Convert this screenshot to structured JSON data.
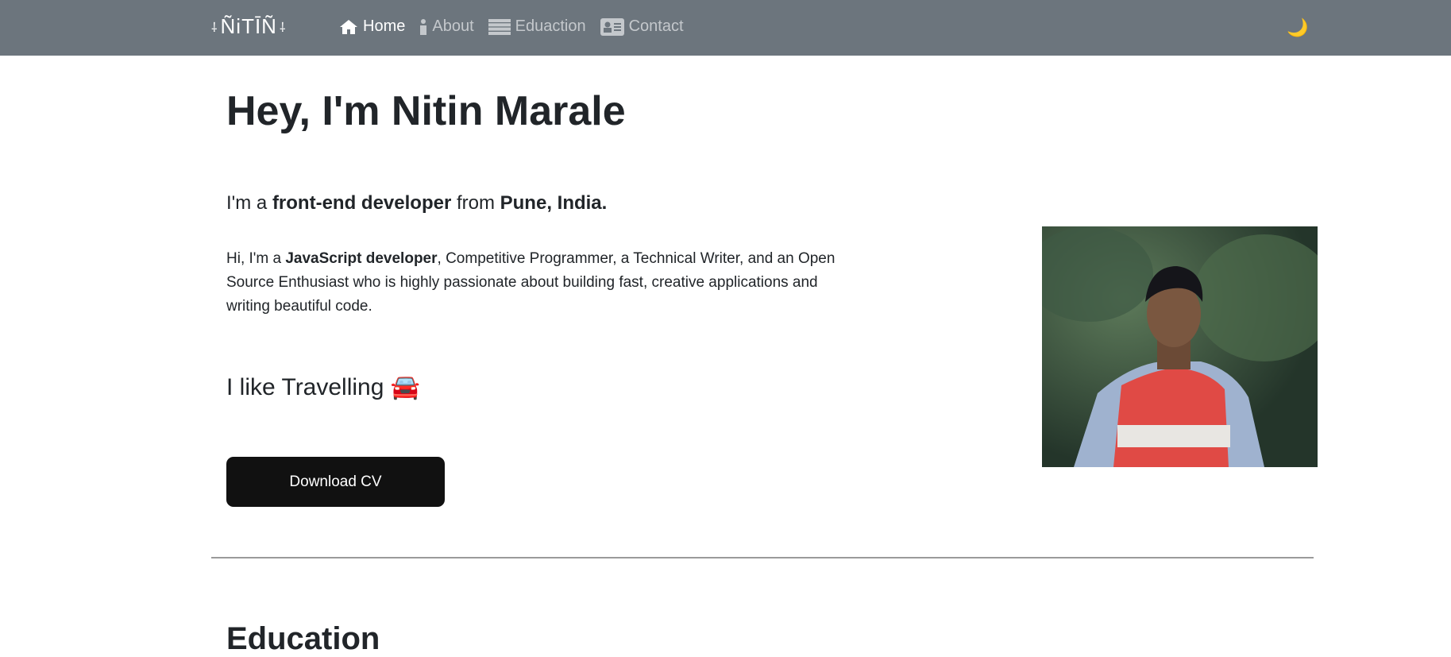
{
  "nav": {
    "logo": "ÑiTĪÑ",
    "logo_ornament": "⸸",
    "links": [
      {
        "label": "Home",
        "icon": "home-icon"
      },
      {
        "label": "About",
        "icon": "info-icon"
      },
      {
        "label": "Eduaction",
        "icon": "list-icon"
      },
      {
        "label": "Contact",
        "icon": "id-card-icon"
      }
    ],
    "theme_toggle": "🌙"
  },
  "hero": {
    "title": "Hey, I'm Nitin Marale",
    "sub": {
      "pre": "I'm a ",
      "role": "front-end developer",
      "mid": " from ",
      "place": "Pune, India."
    },
    "para": {
      "pre": "Hi, I'm a ",
      "bold": "JavaScript developer",
      "rest": ", Competitive Programmer, a Technical Writer, and an Open Source Enthusiast who is highly passionate about building fast, creative applications and writing beautiful code."
    },
    "travel": "I like Travelling 🚘",
    "button": "Download CV"
  },
  "next_heading": "Education"
}
